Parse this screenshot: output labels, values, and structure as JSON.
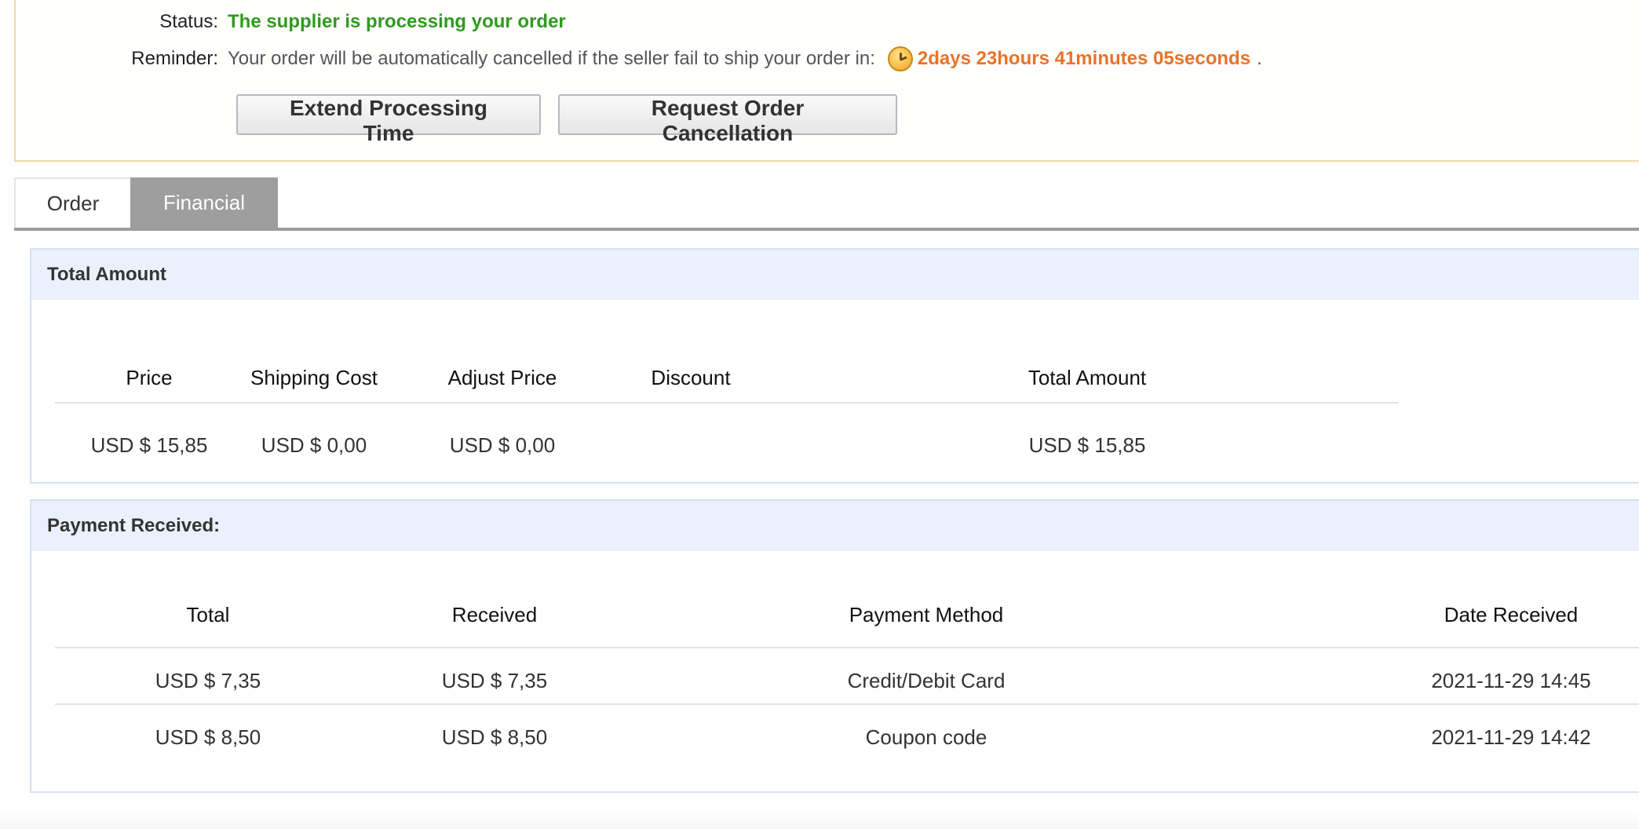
{
  "status_panel": {
    "status_label": "Status:",
    "status_text": "The supplier is processing your order",
    "reminder_label": "Reminder:",
    "reminder_text": "Your order will be automatically cancelled if the seller fail to ship your order in:",
    "countdown": "2days 23hours 41minutes 05seconds",
    "countdown_suffix": ".",
    "extend_button": "Extend Processing Time",
    "cancel_button": "Request Order Cancellation",
    "clock_icon": "clock-icon"
  },
  "tabs": {
    "order": "Order",
    "financial": "Financial",
    "active": "financial"
  },
  "total_amount": {
    "title": "Total Amount",
    "headers": [
      "Price",
      "Shipping Cost",
      "Adjust Price",
      "Discount",
      "Total Amount"
    ],
    "row": [
      "USD $ 15,85",
      "USD $ 0,00",
      "USD $ 0,00",
      "",
      "USD $ 15,85"
    ]
  },
  "payment_received": {
    "title": "Payment Received:",
    "headers": [
      "Total",
      "Received",
      "Payment Method",
      "Date Received"
    ],
    "rows": [
      [
        "USD $ 7,35",
        "USD $ 7,35",
        "Credit/Debit Card",
        "2021-11-29 14:45"
      ],
      [
        "USD $ 8,50",
        "USD $ 8,50",
        "Coupon code",
        "2021-11-29 14:42"
      ]
    ]
  },
  "colors": {
    "status_green": "#2f9a1c",
    "countdown_orange": "#e8732a",
    "section_header_bg": "#eaf1fc",
    "active_tab_bg": "#9e9e9e",
    "panel_border": "#f0d9a8"
  }
}
